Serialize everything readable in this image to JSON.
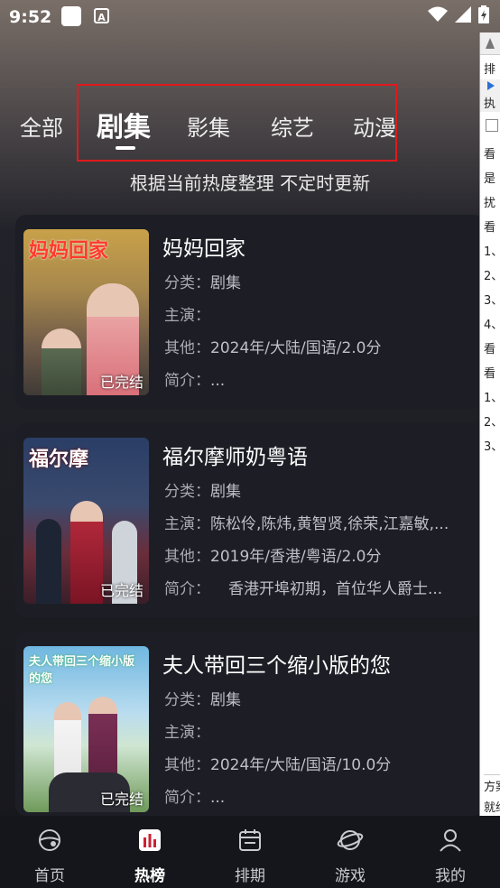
{
  "status_bar": {
    "time": "9:52",
    "notification_letter": "A"
  },
  "tabs": [
    {
      "label": "全部",
      "active": false
    },
    {
      "label": "剧集",
      "active": true
    },
    {
      "label": "影集",
      "active": false
    },
    {
      "label": "综艺",
      "active": false
    },
    {
      "label": "动漫",
      "active": false
    }
  ],
  "subtitle": "根据当前热度整理 不定时更新",
  "cards": [
    {
      "title": "妈妈回家",
      "poster_title": "妈妈回家",
      "badge": "已完结",
      "category_label": "分类：",
      "category": "剧集",
      "cast_label": "主演：",
      "cast": "",
      "other_label": "其他：",
      "other": "2024年/大陆/国语/2.0分",
      "intro_label": "简介：",
      "intro": "..."
    },
    {
      "title": "福尔摩师奶粤语",
      "poster_title": "福尔摩",
      "badge": "已完结",
      "category_label": "分类：",
      "category": "剧集",
      "cast_label": "主演：",
      "cast": "陈松伶,陈炜,黄智贤,徐荣,江嘉敏,...",
      "other_label": "其他：",
      "other": "2019年/香港/粤语/2.0分",
      "intro_label": "简介：",
      "intro": "香港开埠初期，首位华人爵士..."
    },
    {
      "title": "夫人带回三个缩小版的您",
      "poster_title": "夫人带回三个缩小版的您",
      "badge": "已完结",
      "category_label": "分类：",
      "category": "剧集",
      "cast_label": "主演：",
      "cast": "",
      "other_label": "其他：",
      "other": "2024年/大陆/国语/10.0分",
      "intro_label": "简介：",
      "intro": "..."
    }
  ],
  "overlay": {
    "header": "排",
    "button": "执",
    "lines": [
      "看",
      "是",
      "扰",
      "看",
      "1、",
      "2、",
      "3、",
      "4、",
      "看",
      "看",
      "1、",
      "2、",
      "3、"
    ],
    "footer1": "方案",
    "footer2": "就绪"
  },
  "bottom_nav": [
    {
      "label": "首页",
      "icon": "home-planet-icon",
      "active": false
    },
    {
      "label": "热榜",
      "icon": "chart-icon",
      "active": true
    },
    {
      "label": "排期",
      "icon": "calendar-icon",
      "active": false
    },
    {
      "label": "游戏",
      "icon": "game-planet-icon",
      "active": false
    },
    {
      "label": "我的",
      "icon": "profile-icon",
      "active": false
    }
  ],
  "colors": {
    "highlight_box": "#e0191b",
    "card_bg": "#1d1e25",
    "nav_bg": "#15161b"
  }
}
